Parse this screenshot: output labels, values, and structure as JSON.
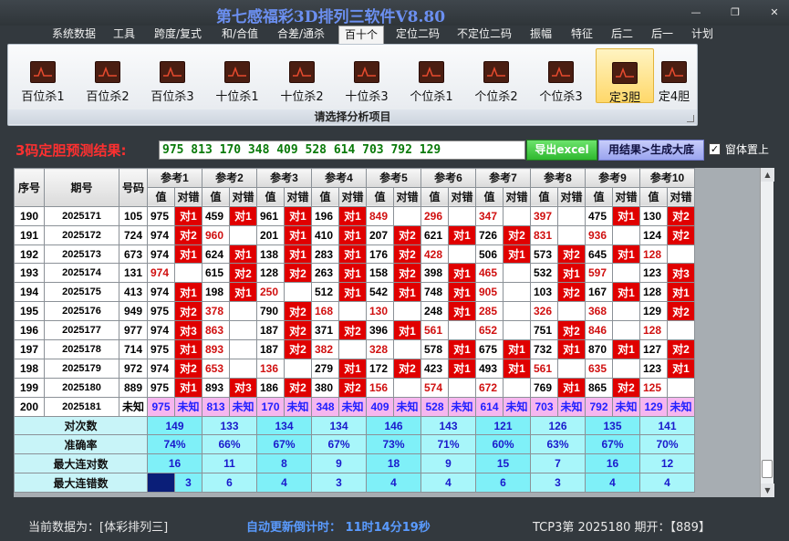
{
  "app": {
    "title": "第七感福彩3D排列三软件V8.80",
    "window_controls": [
      "—",
      "❐",
      "✕"
    ]
  },
  "menu": [
    {
      "label": "系统数据"
    },
    {
      "label": "工具"
    },
    {
      "label": "跨度/复式"
    },
    {
      "label": "和/合值"
    },
    {
      "label": "合差/通杀"
    },
    {
      "label": "百十个",
      "active": true
    },
    {
      "label": "定位二码"
    },
    {
      "label": "不定位二码"
    },
    {
      "label": "振幅"
    },
    {
      "label": "特征"
    },
    {
      "label": "后二"
    },
    {
      "label": "后一"
    },
    {
      "label": "计划"
    }
  ],
  "ribbon": {
    "buttons": [
      {
        "label": "百位杀1",
        "icon": "chart-icon"
      },
      {
        "label": "百位杀2",
        "icon": "chart-icon"
      },
      {
        "label": "百位杀3",
        "icon": "chart-icon"
      },
      {
        "label": "十位杀1",
        "icon": "chart-icon"
      },
      {
        "label": "十位杀2",
        "icon": "chart-icon"
      },
      {
        "label": "十位杀3",
        "icon": "chart-icon"
      },
      {
        "label": "个位杀1",
        "icon": "chart-icon"
      },
      {
        "label": "个位杀2",
        "icon": "chart-icon"
      },
      {
        "label": "个位杀3",
        "icon": "chart-icon"
      },
      {
        "label": "定3胆",
        "icon": "chart-icon",
        "active": true
      },
      {
        "label": "定4胆",
        "icon": "chart-icon"
      }
    ],
    "caption": "请选择分析项目"
  },
  "prediction": {
    "label": "3码定胆预测结果:",
    "value": "975 813 170 348 409 528 614 703 792 129",
    "export_label": "导出excel",
    "generate_label": "用结果>生成大底",
    "pin_label": "窗体置上",
    "pin_checked": true
  },
  "grid": {
    "header": {
      "seq": "序号",
      "issue": "期号",
      "number": "号码",
      "value": "值",
      "check": "对错"
    },
    "refs": [
      "参考1",
      "参考2",
      "参考3",
      "参考4",
      "参考5",
      "参考6",
      "参考7",
      "参考8",
      "参考9",
      "参考10"
    ],
    "rows": [
      {
        "seq": "190",
        "issue": "2025171",
        "num": "105",
        "cells": [
          [
            "975",
            "对1",
            1
          ],
          [
            "459",
            "对1",
            1
          ],
          [
            "961",
            "对1",
            1
          ],
          [
            "196",
            "对1",
            1
          ],
          [
            "849",
            "",
            0
          ],
          [
            "296",
            "",
            0
          ],
          [
            "347",
            "",
            0
          ],
          [
            "397",
            "",
            0
          ],
          [
            "475",
            "对1",
            1
          ],
          [
            "130",
            "对2",
            1
          ]
        ]
      },
      {
        "seq": "191",
        "issue": "2025172",
        "num": "724",
        "cells": [
          [
            "974",
            "对2",
            1
          ],
          [
            "960",
            "",
            0
          ],
          [
            "201",
            "对1",
            1
          ],
          [
            "410",
            "对1",
            1
          ],
          [
            "207",
            "对2",
            1
          ],
          [
            "621",
            "对1",
            1
          ],
          [
            "726",
            "对2",
            1
          ],
          [
            "831",
            "",
            0
          ],
          [
            "936",
            "",
            0
          ],
          [
            "124",
            "对2",
            1
          ]
        ]
      },
      {
        "seq": "192",
        "issue": "2025173",
        "num": "673",
        "cells": [
          [
            "974",
            "对1",
            1
          ],
          [
            "624",
            "对1",
            1
          ],
          [
            "138",
            "对1",
            1
          ],
          [
            "283",
            "对1",
            1
          ],
          [
            "176",
            "对2",
            1
          ],
          [
            "428",
            "",
            0
          ],
          [
            "506",
            "对1",
            1
          ],
          [
            "573",
            "对2",
            1
          ],
          [
            "645",
            "对1",
            1
          ],
          [
            "128",
            "",
            0
          ]
        ]
      },
      {
        "seq": "193",
        "issue": "2025174",
        "num": "131",
        "cells": [
          [
            "974",
            "",
            0
          ],
          [
            "615",
            "对2",
            1
          ],
          [
            "128",
            "对2",
            1
          ],
          [
            "263",
            "对1",
            1
          ],
          [
            "158",
            "对2",
            1
          ],
          [
            "398",
            "对1",
            1
          ],
          [
            "465",
            "",
            0
          ],
          [
            "532",
            "对1",
            1
          ],
          [
            "597",
            "",
            0
          ],
          [
            "123",
            "对3",
            1
          ]
        ]
      },
      {
        "seq": "194",
        "issue": "2025175",
        "num": "413",
        "cells": [
          [
            "974",
            "对1",
            1
          ],
          [
            "198",
            "对1",
            1
          ],
          [
            "250",
            "",
            0
          ],
          [
            "512",
            "对1",
            1
          ],
          [
            "542",
            "对1",
            1
          ],
          [
            "748",
            "对1",
            1
          ],
          [
            "905",
            "",
            0
          ],
          [
            "103",
            "对2",
            1
          ],
          [
            "167",
            "对1",
            1
          ],
          [
            "128",
            "对1",
            1
          ]
        ]
      },
      {
        "seq": "195",
        "issue": "2025176",
        "num": "949",
        "cells": [
          [
            "975",
            "对2",
            1
          ],
          [
            "378",
            "",
            0
          ],
          [
            "790",
            "对2",
            1
          ],
          [
            "168",
            "",
            0
          ],
          [
            "130",
            "",
            0
          ],
          [
            "248",
            "对1",
            1
          ],
          [
            "285",
            "",
            0
          ],
          [
            "326",
            "",
            0
          ],
          [
            "368",
            "",
            0
          ],
          [
            "129",
            "对2",
            1
          ]
        ]
      },
      {
        "seq": "196",
        "issue": "2025177",
        "num": "977",
        "cells": [
          [
            "974",
            "对3",
            1
          ],
          [
            "863",
            "",
            0
          ],
          [
            "187",
            "对2",
            1
          ],
          [
            "371",
            "对2",
            1
          ],
          [
            "396",
            "对1",
            1
          ],
          [
            "561",
            "",
            0
          ],
          [
            "652",
            "",
            0
          ],
          [
            "751",
            "对2",
            1
          ],
          [
            "846",
            "",
            0
          ],
          [
            "128",
            "",
            0
          ]
        ]
      },
      {
        "seq": "197",
        "issue": "2025178",
        "num": "714",
        "cells": [
          [
            "975",
            "对1",
            1
          ],
          [
            "893",
            "",
            0
          ],
          [
            "187",
            "对2",
            1
          ],
          [
            "382",
            "",
            0
          ],
          [
            "328",
            "",
            0
          ],
          [
            "578",
            "对1",
            1
          ],
          [
            "675",
            "对1",
            1
          ],
          [
            "732",
            "对1",
            1
          ],
          [
            "870",
            "对1",
            1
          ],
          [
            "127",
            "对2",
            1
          ]
        ]
      },
      {
        "seq": "198",
        "issue": "2025179",
        "num": "972",
        "cells": [
          [
            "974",
            "对2",
            1
          ],
          [
            "653",
            "",
            0
          ],
          [
            "136",
            "",
            0
          ],
          [
            "279",
            "对1",
            1
          ],
          [
            "172",
            "对2",
            1
          ],
          [
            "423",
            "对1",
            1
          ],
          [
            "493",
            "对1",
            1
          ],
          [
            "561",
            "",
            0
          ],
          [
            "635",
            "",
            0
          ],
          [
            "123",
            "对1",
            1
          ]
        ]
      },
      {
        "seq": "199",
        "issue": "2025180",
        "num": "889",
        "cells": [
          [
            "975",
            "对1",
            1
          ],
          [
            "893",
            "对3",
            1
          ],
          [
            "186",
            "对2",
            1
          ],
          [
            "380",
            "对2",
            1
          ],
          [
            "156",
            "",
            0
          ],
          [
            "574",
            "",
            0
          ],
          [
            "672",
            "",
            0
          ],
          [
            "769",
            "对1",
            1
          ],
          [
            "865",
            "对2",
            1
          ],
          [
            "125",
            "",
            0
          ]
        ]
      }
    ],
    "current": {
      "seq": "200",
      "issue": "2025181",
      "num": "未知",
      "values": [
        "975",
        "813",
        "170",
        "348",
        "409",
        "528",
        "614",
        "703",
        "792",
        "129"
      ],
      "unknown": "未知"
    },
    "stats": [
      {
        "label": "对次数",
        "values": [
          "149",
          "133",
          "134",
          "134",
          "146",
          "143",
          "121",
          "126",
          "135",
          "141"
        ]
      },
      {
        "label": "准确率",
        "values": [
          "74%",
          "66%",
          "67%",
          "67%",
          "73%",
          "71%",
          "60%",
          "63%",
          "67%",
          "70%"
        ]
      },
      {
        "label": "最大连对数",
        "values": [
          "16",
          "11",
          "8",
          "9",
          "18",
          "9",
          "15",
          "7",
          "16",
          "12"
        ]
      },
      {
        "label": "最大连错数",
        "values": [
          "3",
          "6",
          "4",
          "3",
          "4",
          "4",
          "6",
          "3",
          "4",
          "4"
        ]
      }
    ]
  },
  "status": {
    "source": "当前数据为：[体彩排列三]",
    "countdown": "自动更新倒计时： 11时14分19秒",
    "draw": "TCP3第 2025180 期开：【889】"
  }
}
